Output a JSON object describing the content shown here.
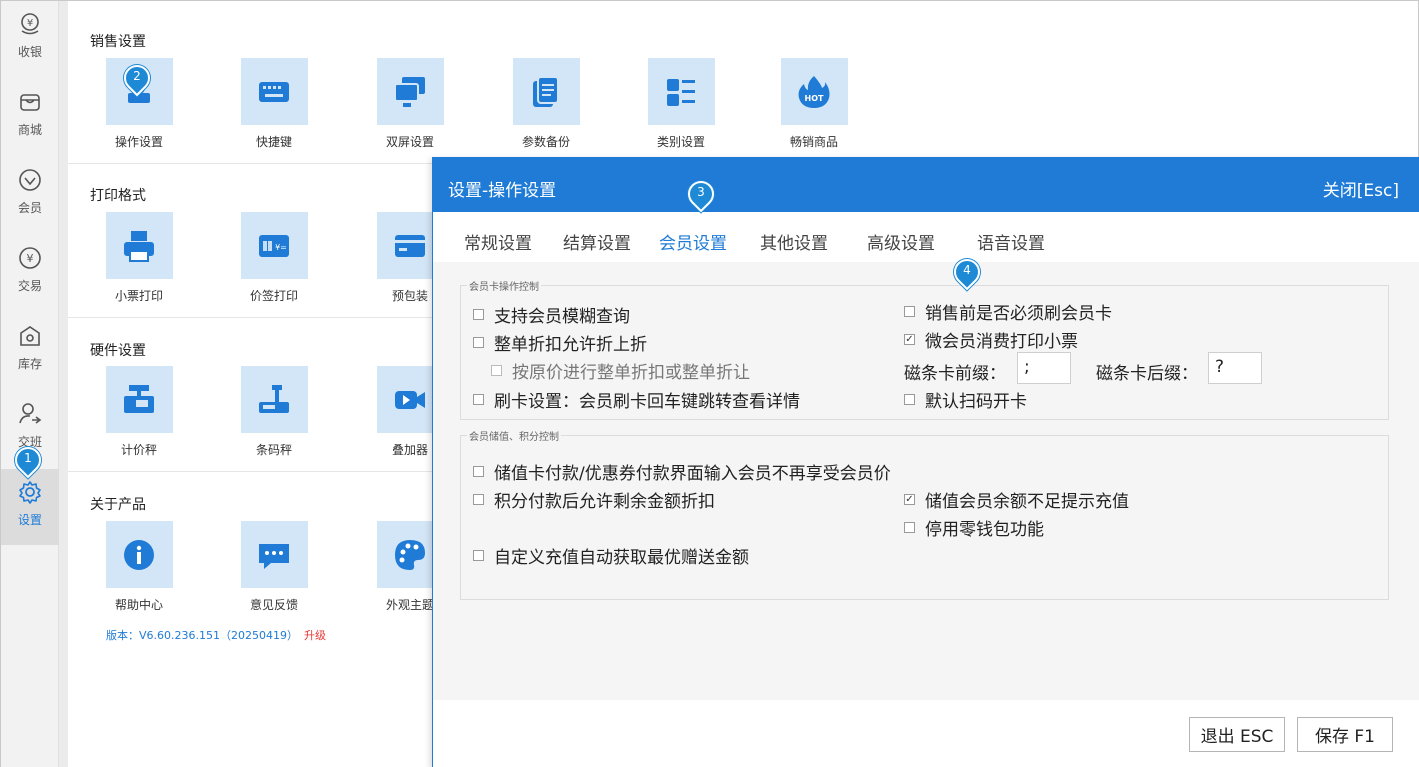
{
  "sidebar": {
    "items": [
      {
        "label": "收银",
        "icon": "cashier-icon"
      },
      {
        "label": "商城",
        "icon": "store-icon"
      },
      {
        "label": "会员",
        "icon": "member-icon"
      },
      {
        "label": "交易",
        "icon": "transaction-icon"
      },
      {
        "label": "库存",
        "icon": "inventory-icon"
      },
      {
        "label": "交班",
        "icon": "shift-icon"
      },
      {
        "label": "设置",
        "icon": "gear-icon"
      }
    ],
    "active": "设置"
  },
  "sections": [
    {
      "title": "销售设置",
      "tiles": [
        "操作设置",
        "快捷键",
        "双屏设置",
        "参数备份",
        "类别设置",
        "畅销商品"
      ]
    },
    {
      "title": "打印格式",
      "tiles": [
        "小票打印",
        "价签打印",
        "预包装"
      ]
    },
    {
      "title": "硬件设置",
      "tiles": [
        "计价秤",
        "条码秤",
        "叠加器"
      ]
    },
    {
      "title": "关于产品",
      "tiles": [
        "帮助中心",
        "意见反馈",
        "外观主题"
      ]
    }
  ],
  "version": {
    "text": "版本：V6.60.236.151（20250419）",
    "upgrade": "升级"
  },
  "markers": [
    "1",
    "2",
    "3",
    "4"
  ],
  "dialog": {
    "title": "设置-操作设置",
    "close": "关闭[Esc]",
    "tabs": [
      "常规设置",
      "结算设置",
      "会员设置",
      "其他设置",
      "高级设置",
      "语音设置"
    ],
    "active_tab": "会员设置",
    "group1": {
      "title": "会员卡操作控制",
      "left": [
        {
          "label": "支持会员模糊查询",
          "checked": false
        },
        {
          "label": "整单折扣允许折上折",
          "checked": false
        },
        {
          "label": "按原价进行整单折扣或整单折让",
          "checked": false
        },
        {
          "label": "刷卡设置：会员刷卡回车键跳转查看详情",
          "checked": false
        }
      ],
      "right": [
        {
          "label": "销售前是否必须刷会员卡",
          "checked": false
        },
        {
          "label": "微会员消费打印小票",
          "checked": true
        },
        {
          "label": "默认扫码开卡",
          "checked": false
        }
      ],
      "prefix_label": "磁条卡前缀：",
      "prefix_value": ";",
      "suffix_label": "磁条卡后缀：",
      "suffix_value": "?"
    },
    "group2": {
      "title": "会员储值、积分控制",
      "items": [
        {
          "label": "储值卡付款/优惠券付款界面输入会员不再享受会员价",
          "checked": false
        },
        {
          "label": "积分付款后允许剩余金额折扣",
          "checked": false
        },
        {
          "label": "储值会员余额不足提示充值",
          "checked": true
        },
        {
          "label": "停用零钱包功能",
          "checked": false
        },
        {
          "label": "自定义充值自动获取最优赠送金额",
          "checked": false
        }
      ]
    },
    "buttons": {
      "exit": "退出 ESC",
      "save": "保存 F1"
    }
  },
  "colors": {
    "primary": "#1f7bd6",
    "tile_bg": "#d3e6f7",
    "upgrade": "#e53935"
  }
}
